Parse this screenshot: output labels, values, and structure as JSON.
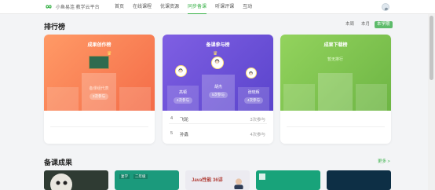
{
  "brand": {
    "name": "小鱼易连 教学云平台",
    "logo_icon": "infinity-logo-icon",
    "accent": "#3bb24a"
  },
  "nav": [
    {
      "label": "首页",
      "active": false
    },
    {
      "label": "在线课程",
      "active": false
    },
    {
      "label": "优课资源",
      "active": false
    },
    {
      "label": "同步备课",
      "active": true
    },
    {
      "label": "听课评课",
      "active": false
    },
    {
      "label": "互动",
      "active": false
    }
  ],
  "ranking": {
    "title": "排行榜",
    "periods": [
      {
        "label": "本周",
        "active": false
      },
      {
        "label": "本月",
        "active": false
      },
      {
        "label": "本学期",
        "active": true
      }
    ],
    "cards": [
      {
        "title": "成果创作榜",
        "colors": [
          "#ff8f5e",
          "#f5704a"
        ],
        "first": {
          "name": "备课组代表",
          "count": "2次参与"
        },
        "list": []
      },
      {
        "title": "备课参与榜",
        "colors": [
          "#7a5ce0",
          "#5f47cf"
        ],
        "second": {
          "name": "高顿",
          "count": "4次参与"
        },
        "first": {
          "name": "胡杰",
          "count": "5次参与"
        },
        "third": {
          "name": "张晓辉",
          "count": "4次参与"
        },
        "list": [
          {
            "rank": "4",
            "name": "飞轮",
            "count": "3次参与"
          },
          {
            "rank": "5",
            "name": "孙鑫",
            "count": "4次参与"
          }
        ]
      },
      {
        "title": "成果下载榜",
        "colors": [
          "#8fcf5a",
          "#6fba46"
        ],
        "first": {
          "name": "暂无排行"
        },
        "list": []
      }
    ]
  },
  "achievements": {
    "title": "备课成果",
    "more_label": "更多 >"
  },
  "thumbnails": [
    {
      "color": "#2f3b33"
    },
    {
      "color": "#1b9a7c",
      "tag": "复学",
      "tag2": "二年级"
    },
    {
      "color": "#e8e8ee",
      "text": "Java性能 36讲"
    },
    {
      "color": "#18a37a"
    },
    {
      "color": "#0d2f45"
    }
  ]
}
